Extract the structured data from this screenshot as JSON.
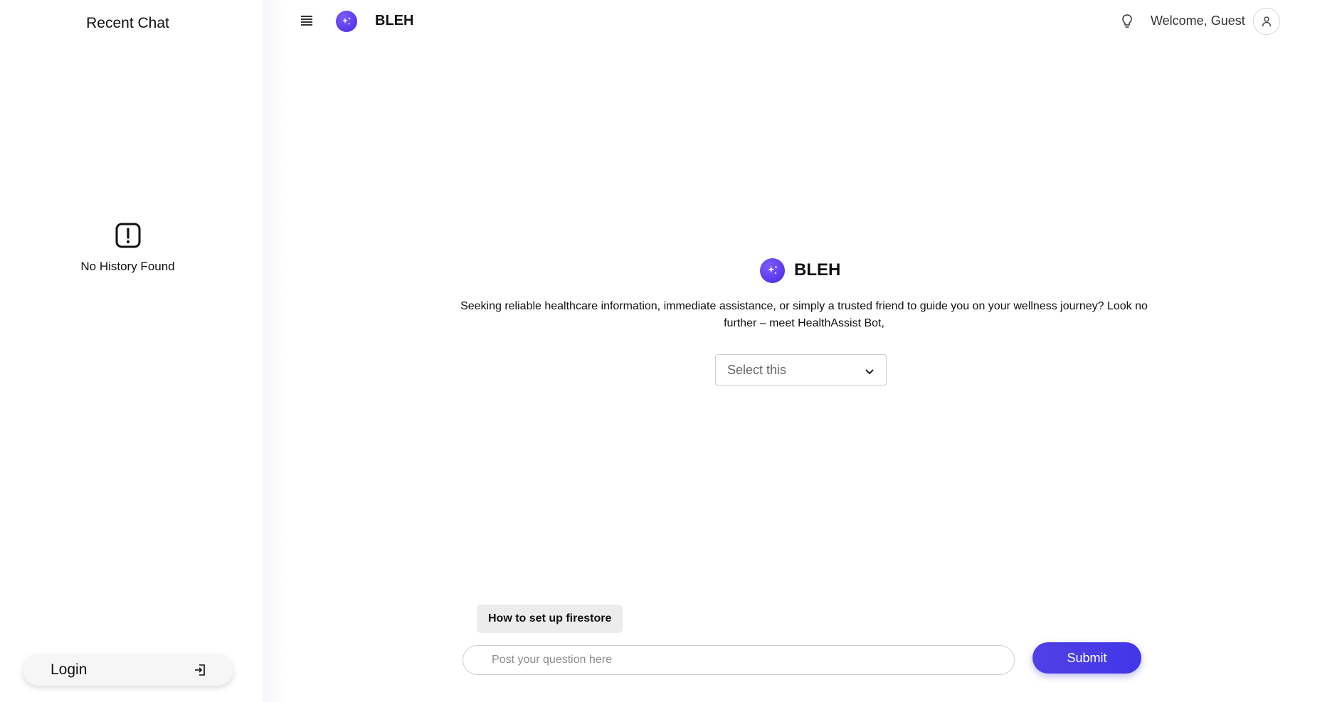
{
  "sidebar": {
    "title": "Recent Chat",
    "empty_state": {
      "icon": "alert-square-icon",
      "text": "No History Found"
    },
    "login": {
      "label": "Login",
      "icon": "login-icon"
    }
  },
  "header": {
    "menu_icon": "menu-icon",
    "brand": {
      "name": "BLEH",
      "logo_icon": "sparkle-icon"
    },
    "theme_icon": "lightbulb-icon",
    "welcome": "Welcome, Guest",
    "avatar_icon": "user-icon"
  },
  "hero": {
    "name": "BLEH",
    "description": "Seeking reliable healthcare information, immediate assistance, or simply a trusted friend to guide you on your wellness journey? Look no further – meet HealthAssist Bot,"
  },
  "select": {
    "selected": "Select this",
    "icon": "chevron-down-icon"
  },
  "suggestion": {
    "label": "How to set up firestore"
  },
  "composer": {
    "placeholder": "Post your question here",
    "submit_label": "Submit"
  },
  "colors": {
    "accent": "#4b3be6",
    "brand_gradient_start": "#7b5cff",
    "brand_gradient_end": "#4b26e0",
    "chip_bg": "#ececec"
  }
}
